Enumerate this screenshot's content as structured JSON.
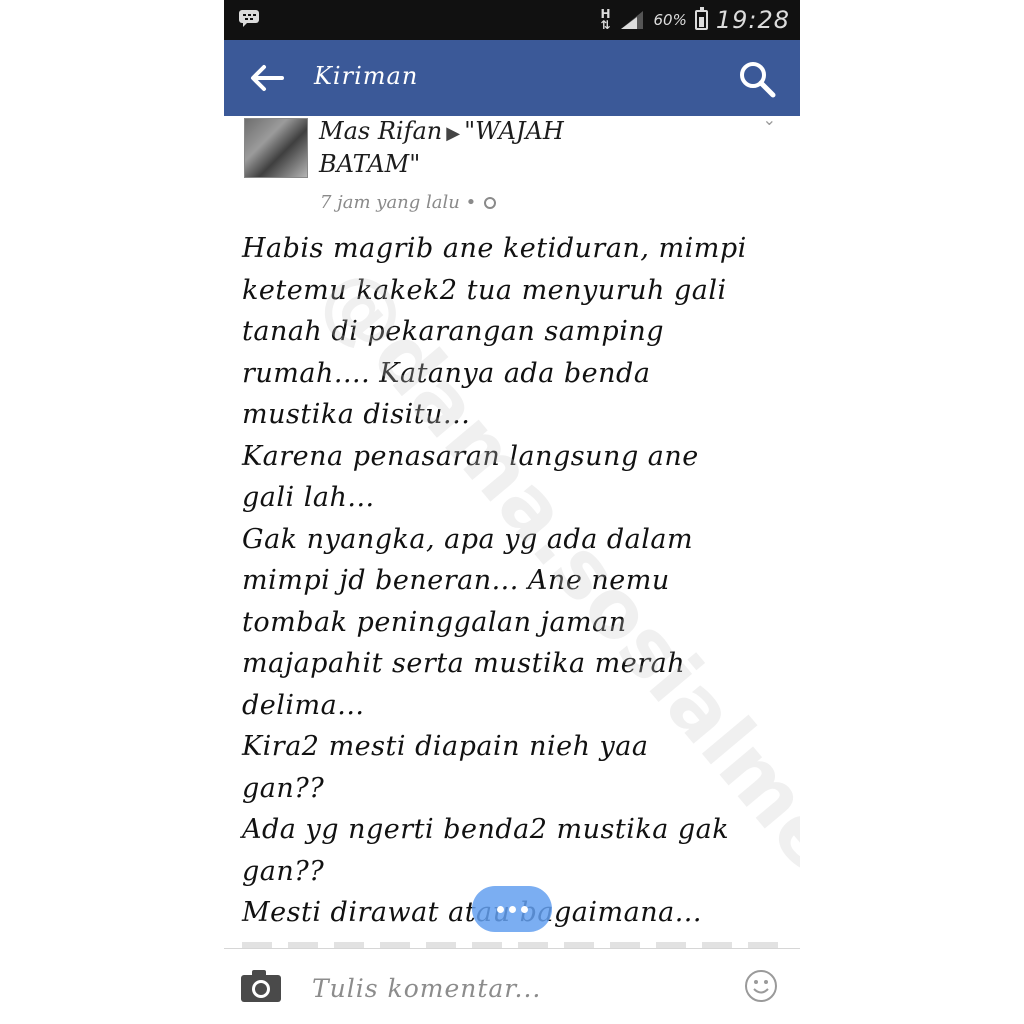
{
  "status_bar": {
    "network": "H",
    "battery": "60%",
    "time": "19:28"
  },
  "app_bar": {
    "title": "Kiriman",
    "back_icon": "arrow-left-icon",
    "search_icon": "search-icon"
  },
  "post": {
    "author": "Mas Rifan",
    "group": "\"WAJAH BATAM\"",
    "time": "7 jam yang lalu •",
    "body_lines": [
      "Habis magrib ane ketiduran, mimpi",
      "ketemu kakek2 tua menyuruh gali",
      "tanah di pekarangan samping",
      "rumah.... Katanya ada benda",
      "mustika disitu...",
      "Karena penasaran langsung ane",
      "gali lah...",
      "Gak nyangka, apa yg ada dalam",
      "mimpi jd beneran... Ane nemu",
      "tombak peninggalan jaman",
      "majapahit serta mustika merah",
      "delima...",
      "Kira2 mesti diapain nieh yaa",
      "gan??",
      "Ada yg ngerti benda2 mustika gak",
      "gan??",
      "Mesti dirawat atau bagaimana..."
    ]
  },
  "watermark": "@dama.sosialmedia",
  "comment_bar": {
    "placeholder": "Tulis komentar...",
    "camera_icon": "camera-icon",
    "smiley_icon": "smiley-icon"
  },
  "colors": {
    "app_bar": "#3b5998",
    "status_bar": "#111111",
    "more_pill": "#64a0f0"
  }
}
